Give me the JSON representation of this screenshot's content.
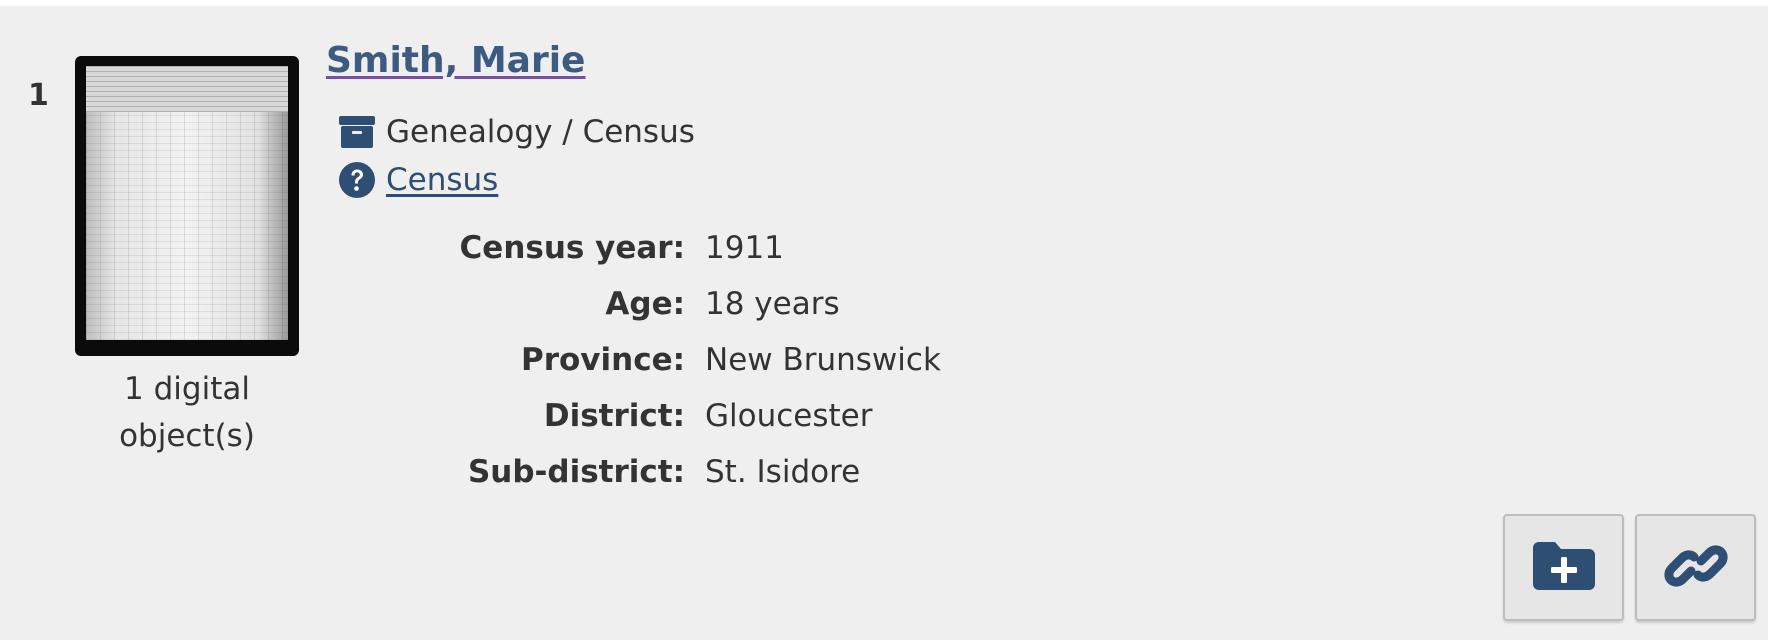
{
  "result": {
    "number": "1",
    "title": "Smith, Marie",
    "thumbnail": {
      "caption": "1 digital object(s)"
    },
    "type_path": "Genealogy / Census",
    "collection_link": "Census",
    "fields": [
      {
        "label": "Census year:",
        "value": "1911"
      },
      {
        "label": "Age:",
        "value": "18 years"
      },
      {
        "label": "Province:",
        "value": "New Brunswick"
      },
      {
        "label": "District:",
        "value": "Gloucester"
      },
      {
        "label": "Sub-district:",
        "value": "St. Isidore"
      }
    ],
    "actions": [
      {
        "icon": "folder-plus-icon"
      },
      {
        "icon": "link-icon"
      }
    ]
  },
  "colors": {
    "accent": "#2f4e73",
    "background": "#efefef",
    "text": "#333333"
  }
}
